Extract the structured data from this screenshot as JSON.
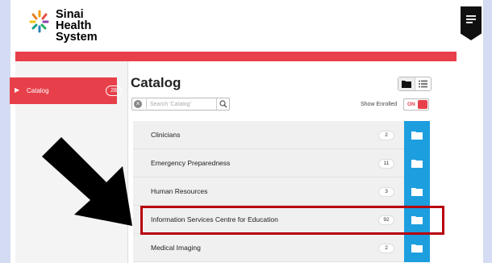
{
  "brand": {
    "line1": "Sinai",
    "line2": "Health",
    "line3": "System"
  },
  "sidebar": {
    "item_label": "Catalog",
    "item_count": "28"
  },
  "main": {
    "title": "Catalog",
    "search_placeholder": "Search 'Catalog'",
    "show_enrolled_label": "Show Enrolled",
    "toggle_label": "ON"
  },
  "categories": [
    {
      "title": "Clinicians",
      "count": "2"
    },
    {
      "title": "Emergency Preparedness",
      "count": "11"
    },
    {
      "title": "Human Resources",
      "count": "3"
    },
    {
      "title": "Information Services Centre for Education",
      "count": "92"
    },
    {
      "title": "Medical Imaging",
      "count": "2"
    }
  ],
  "colors": {
    "accent_red": "#e7404a",
    "folder_blue": "#1d9ede",
    "highlight": "#b8000d"
  },
  "icons": [
    "menu-icon",
    "chevron-right-icon",
    "clear-icon",
    "search-icon",
    "folder-icon",
    "list-icon"
  ]
}
